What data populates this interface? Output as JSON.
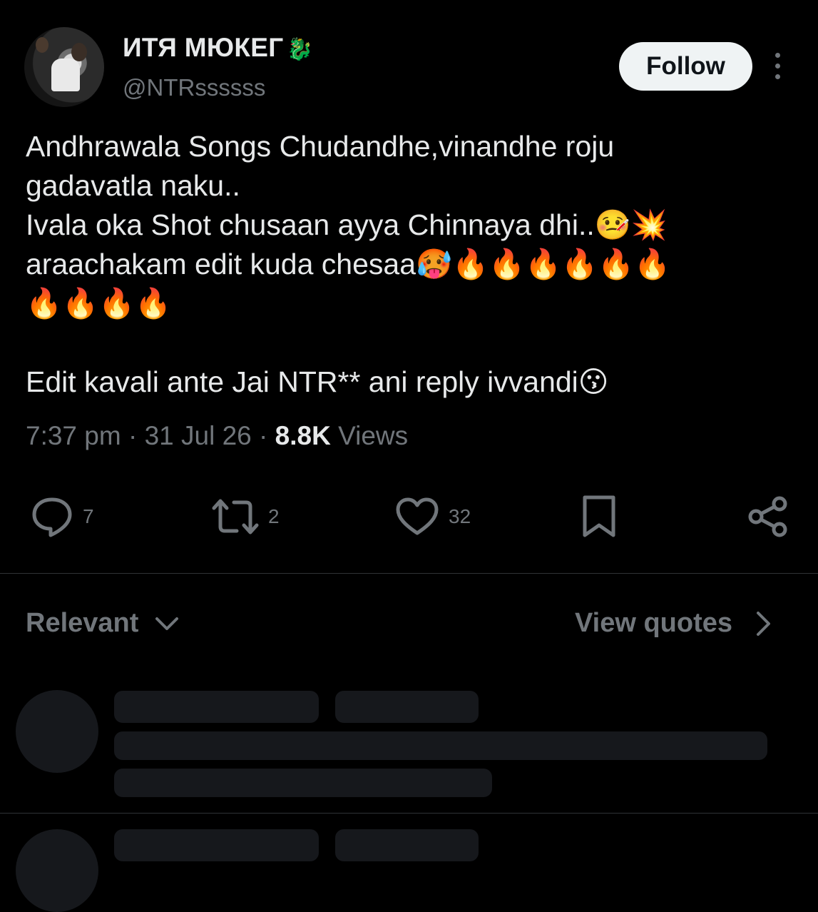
{
  "author": {
    "display_name": "ИТЯ МЮКЕГ",
    "name_emoji": "🐉",
    "handle": "@NTRssssss",
    "follow_label": "Follow"
  },
  "tweet": {
    "lines": [
      "Andhrawala Songs Chudandhe,vinandhe roju",
      "gadavatla naku..",
      "Ivala oka Shot chusaan ayya Chinnaya dhi..🤒💥",
      "araachakam edit kuda chesaa🥵🔥🔥🔥🔥🔥🔥",
      "🔥🔥🔥🔥",
      "Edit kavali ante Jai NTR** ani reply ivvandi😗"
    ],
    "time": "7:37 pm",
    "date": "31 Jul 26",
    "views_count": "8.8K",
    "views_label": "Views"
  },
  "actions": {
    "replies": "7",
    "reposts": "2",
    "likes": "32"
  },
  "sort": {
    "relevant_label": "Relevant",
    "view_quotes_label": "View quotes"
  },
  "icons": [
    "more-vertical-icon",
    "reply-icon",
    "repost-icon",
    "like-icon",
    "bookmark-icon",
    "share-icon",
    "chevron-down-icon",
    "chevron-right-icon"
  ]
}
